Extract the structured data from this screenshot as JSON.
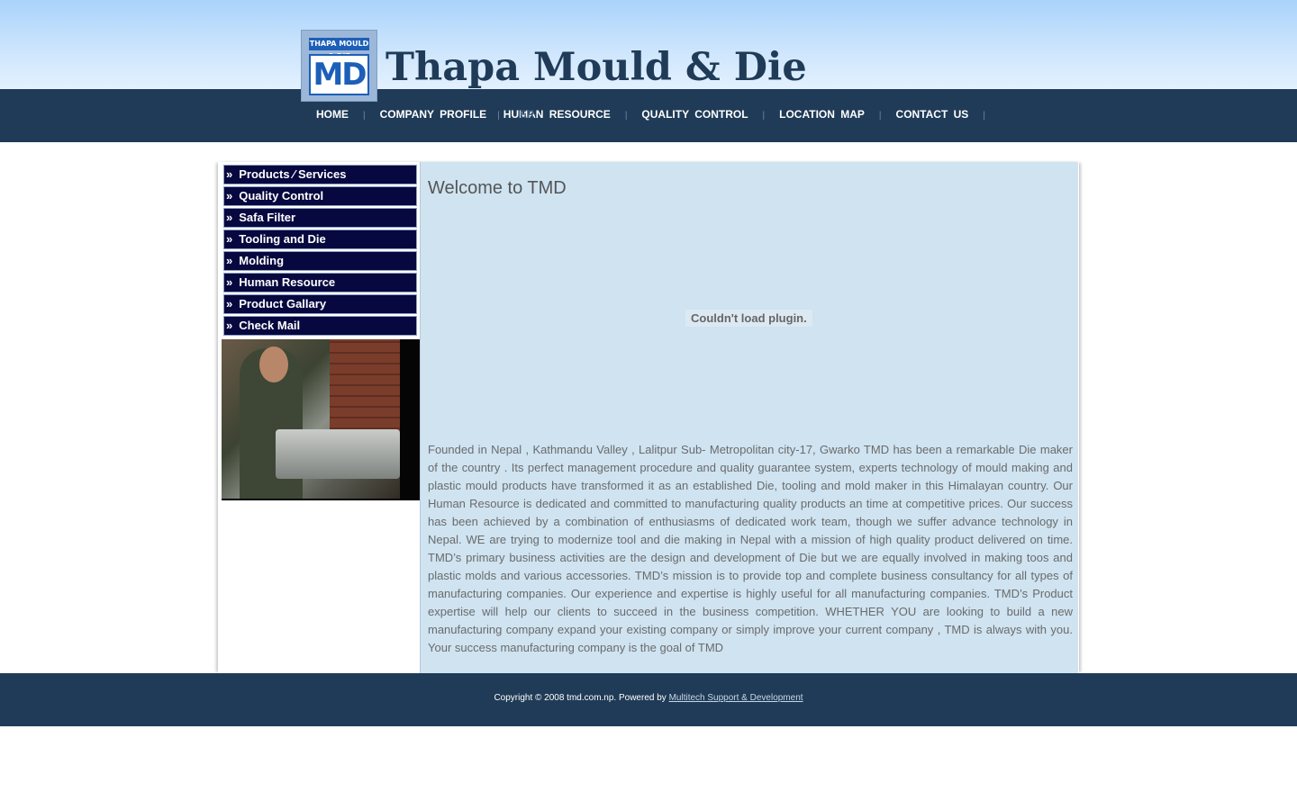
{
  "header": {
    "logo_top_text": "THAPA MOULD & DIE",
    "logo_letters": "MD",
    "site_title": "Thapa Mould & Die"
  },
  "nav": {
    "items": [
      {
        "label": "HOME"
      },
      {
        "label": "COMPANY PROFILE"
      },
      {
        "label": "HUMAN RESOURCE"
      },
      {
        "label": "QUALITY CONTROL"
      },
      {
        "label": "LOCATION MAP"
      },
      {
        "label": "CONTACT US"
      }
    ],
    "separator": "|",
    "ghost_text": "ER"
  },
  "sidebar": {
    "bullet": "»",
    "items": [
      {
        "label": "Products ⁄ Services"
      },
      {
        "label": "Quality Control"
      },
      {
        "label": "Safa Filter"
      },
      {
        "label": "Tooling and Die"
      },
      {
        "label": "Molding"
      },
      {
        "label": "Human Resource"
      },
      {
        "label": "Product Gallary"
      },
      {
        "label": "Check Mail"
      }
    ]
  },
  "main": {
    "heading": "Welcome to TMD",
    "plugin_message": "Couldn't load plugin.",
    "body": "Founded in Nepal , Kathmandu Valley , Lalitpur Sub- Metropolitan city-17, Gwarko TMD has been a remarkable Die maker of the country . Its perfect management procedure and quality guarantee system, experts technology of mould making and plastic mould products have transformed it as an established Die, tooling and mold maker in this Himalayan country. Our Human Resource is dedicated and committed to manufacturing quality products an time at competitive prices. Our success has been achieved by a combination of enthusiasms of dedicated work team, though we suffer advance technology in Nepal. WE are trying to modernize tool and die making in Nepal with a mission of high quality product delivered on time. TMD’s primary business activities are the design and development of Die but we are equally involved in making toos and plastic molds and various accessories. TMD’s mission is to provide top and complete business consultancy for all types of manufacturing companies. Our experience and expertise is highly useful for all manufacturing companies. TMD’s Product expertise will help our clients to succeed in the business competition. WHETHER YOU are looking to build a new manufacturing company expand your existing company or simply improve your current company , TMD is always with you. Your success manufacturing company is the goal of TMD"
  },
  "footer": {
    "copyright": "Copyright © 2008 tmd.com.np. Powered by ",
    "link_text": "Multitech Support & Development"
  },
  "colors": {
    "header_gradient_top": "#a9d3fb",
    "nav_bar": "#1f3b57",
    "menu_item_bg": "#07083f",
    "content_bg": "#cfe3f1",
    "title_color": "#1f3b57"
  }
}
